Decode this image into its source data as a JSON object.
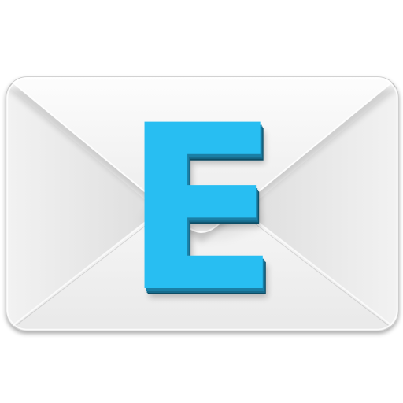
{
  "icon": {
    "name": "envelope-app-icon",
    "letter": "E",
    "colors": {
      "letter_front": "#28bef2",
      "letter_side": "#1a7fa6",
      "letter_shadow": "#0d4d66",
      "envelope_light": "#fbfbfb",
      "envelope_mid": "#e6e6e6",
      "envelope_dark": "#c9c9c9",
      "envelope_edge": "#bdbdbd"
    }
  }
}
